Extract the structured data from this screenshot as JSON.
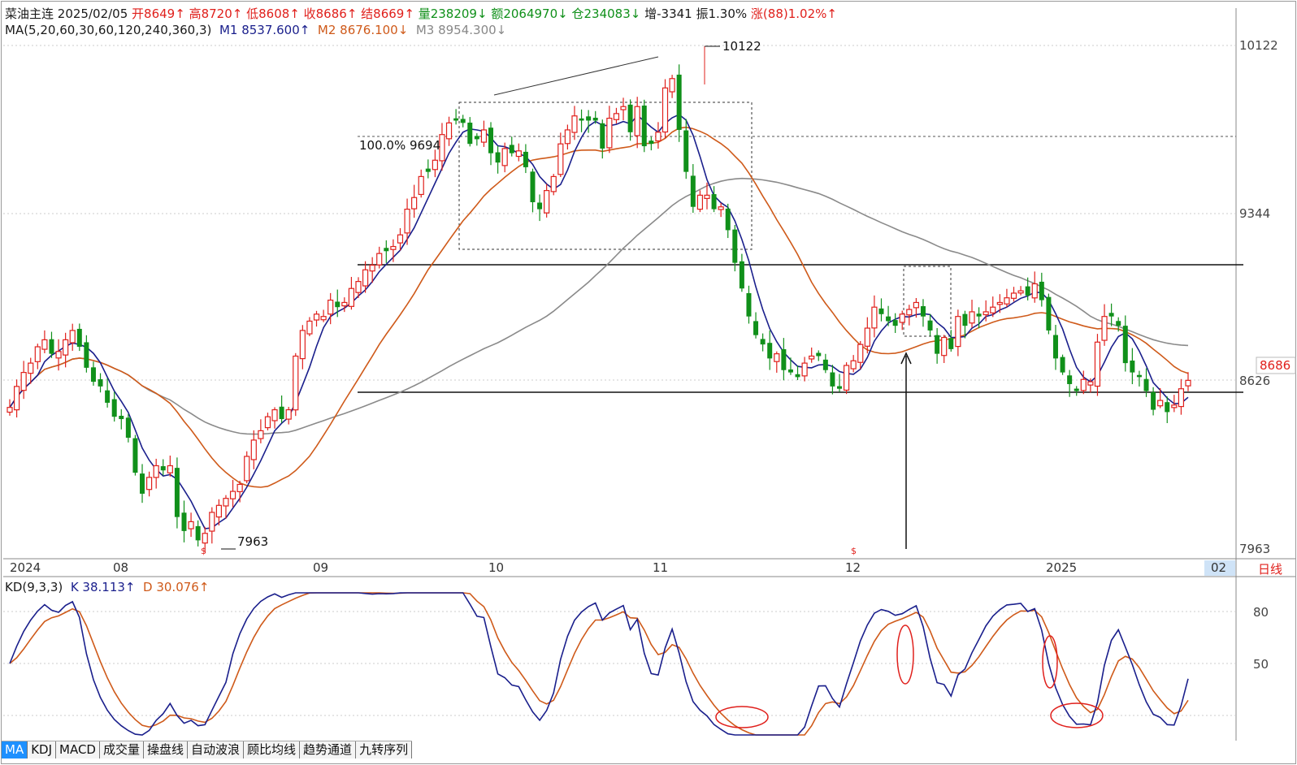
{
  "header": {
    "name": "菜油主连",
    "date": "2025/02/05",
    "open": "开8649↑",
    "high": "高8720↑",
    "low": "低8608↑",
    "close": "收8686↑",
    "settle": "结8669↑",
    "volume": "量238209↓",
    "amount": "额2064970↓",
    "oi": "仓234083↓",
    "oi_change": "增-3341",
    "amplitude": "振1.30%",
    "change": "涨(88)1.02%↑"
  },
  "ma_line": {
    "label": "MA(5,20,60,30,60,120,240,360,3)",
    "m1": "M1 8537.600↑",
    "m2": "M2 8676.100↓",
    "m3": "M3 8954.300↓"
  },
  "price_axis": {
    "p10122": "10122",
    "p9344": "9344",
    "p8626": "8626",
    "p7963": "7963",
    "last": "8686"
  },
  "annotations": {
    "high_label": "10122",
    "low_label": "7963",
    "fib_label": "100.0% 9694",
    "s_marker": "$"
  },
  "date_axis": {
    "y2024": "2024",
    "m08": "08",
    "m09": "09",
    "m10": "10",
    "m11": "11",
    "m12": "12",
    "y2025": "2025",
    "m02": "02",
    "period": "日线"
  },
  "kd": {
    "label": "KD(9,3,3)",
    "k": "K 38.113↑",
    "d": "D 30.076↑",
    "t80": "80",
    "t50": "50"
  },
  "tabs": [
    "MA",
    "KDJ",
    "MACD",
    "成交量",
    "操盘线",
    "自动波浪",
    "顾比均线",
    "趋势通道",
    "九转序列"
  ],
  "colors": {
    "up": "#e0201c",
    "down": "#10901a",
    "m1": "#1a1f8c",
    "m2": "#cf5a1a",
    "m3": "#8a8a8a",
    "circle": "#e0201c"
  },
  "chart_data": [
    {
      "type": "candlestick",
      "title": "菜油主连",
      "period": "日线",
      "ylim": [
        7963,
        10122
      ],
      "x_ticks": [
        "2024",
        "08",
        "09",
        "10",
        "11",
        "12",
        "2025",
        "02"
      ],
      "y_ticks": [
        7963,
        8626,
        9344,
        10122
      ],
      "horizontal_levels": [
        9694,
        9200,
        8640
      ],
      "closes": [
        8570,
        8660,
        8720,
        8760,
        8830,
        8860,
        8800,
        8810,
        8860,
        8900,
        8830,
        8740,
        8680,
        8660,
        8590,
        8530,
        8520,
        8440,
        8290,
        8200,
        8270,
        8320,
        8300,
        8320,
        8100,
        8040,
        8080,
        8000,
        8030,
        8120,
        8150,
        8180,
        8210,
        8240,
        8360,
        8430,
        8470,
        8530,
        8560,
        8520,
        8560,
        8790,
        8900,
        8940,
        8970,
        8960,
        9030,
        9000,
        9020,
        9080,
        9110,
        9160,
        9180,
        9230,
        9240,
        9260,
        9310,
        9420,
        9470,
        9560,
        9580,
        9630,
        9740,
        9790,
        9800,
        9790,
        9700,
        9720,
        9760,
        9660,
        9620,
        9680,
        9660,
        9670,
        9600,
        9450,
        9420,
        9500,
        9560,
        9700,
        9760,
        9820,
        9800,
        9800,
        9800,
        9680,
        9810,
        9830,
        9860,
        9750,
        9860,
        9690,
        9700,
        9750,
        9940,
        9980,
        9760,
        9580,
        9430,
        9480,
        9480,
        9420,
        9430,
        9330,
        9190,
        9080,
        8960,
        8880,
        8840,
        8780,
        8800,
        8730,
        8720,
        8700,
        8760,
        8790,
        8790,
        8730,
        8660,
        8650,
        8750,
        8770,
        8840,
        8910,
        9000,
        8970,
        8940,
        8920,
        8970,
        8990,
        9020,
        8960,
        8900,
        8800,
        8870,
        8820,
        8960,
        8920,
        8980,
        8960,
        8980,
        9000,
        9020,
        9040,
        9060,
        9070,
        9050,
        9100,
        9030,
        8900,
        8780,
        8720,
        8670,
        8640,
        8690,
        8680,
        8850,
        8960,
        8960,
        8920,
        8760,
        8720,
        8700,
        8640,
        8560,
        8600,
        8550,
        8580,
        8650,
        8686
      ]
    },
    {
      "type": "line",
      "title": "KD(9,3,3)",
      "y_ticks": [
        50,
        80
      ],
      "series": [
        {
          "name": "K",
          "last": 38.113
        },
        {
          "name": "D",
          "last": 30.076
        }
      ]
    }
  ]
}
